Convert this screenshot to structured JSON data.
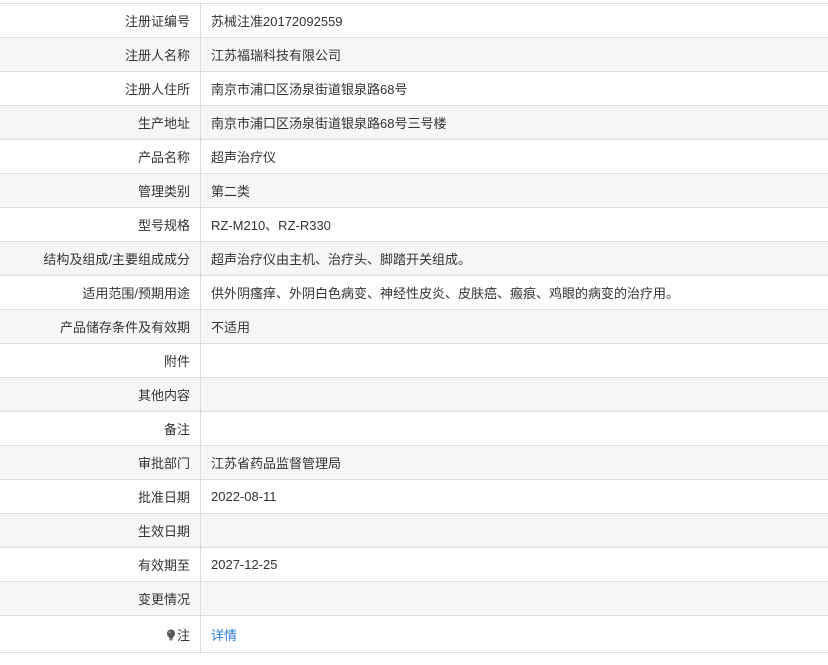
{
  "rows": [
    {
      "label": "注册证编号",
      "value": "苏械注准20172092559"
    },
    {
      "label": "注册人名称",
      "value": "江苏福瑞科技有限公司"
    },
    {
      "label": "注册人住所",
      "value": "南京市浦口区汤泉街道银泉路68号"
    },
    {
      "label": "生产地址",
      "value": "南京市浦口区汤泉街道银泉路68号三号楼"
    },
    {
      "label": "产品名称",
      "value": "超声治疗仪"
    },
    {
      "label": "管理类别",
      "value": "第二类"
    },
    {
      "label": "型号规格",
      "value": "RZ-M210、RZ-R330"
    },
    {
      "label": "结构及组成/主要组成成分",
      "value": "超声治疗仪由主机、治疗头、脚踏开关组成。"
    },
    {
      "label": "适用范围/预期用途",
      "value": "供外阴瘙痒、外阴白色病变、神经性皮炎、皮肤癌、瘢痕、鸡眼的病变的治疗用。"
    },
    {
      "label": "产品储存条件及有效期",
      "value": "不适用"
    },
    {
      "label": "附件",
      "value": ""
    },
    {
      "label": "其他内容",
      "value": ""
    },
    {
      "label": "备注",
      "value": ""
    },
    {
      "label": "审批部门",
      "value": "江苏省药品监督管理局"
    },
    {
      "label": "批准日期",
      "value": "2022-08-11"
    },
    {
      "label": "生效日期",
      "value": ""
    },
    {
      "label": "有效期至",
      "value": "2027-12-25"
    },
    {
      "label": "变更情况",
      "value": ""
    }
  ],
  "note": {
    "icon": "lightbulb-icon",
    "label": "注",
    "link_text": "详情"
  },
  "colors": {
    "alt_row_bg": "#f5f6f8",
    "border": "#dddddd",
    "link": "#2e7bd6",
    "text": "#333333"
  }
}
